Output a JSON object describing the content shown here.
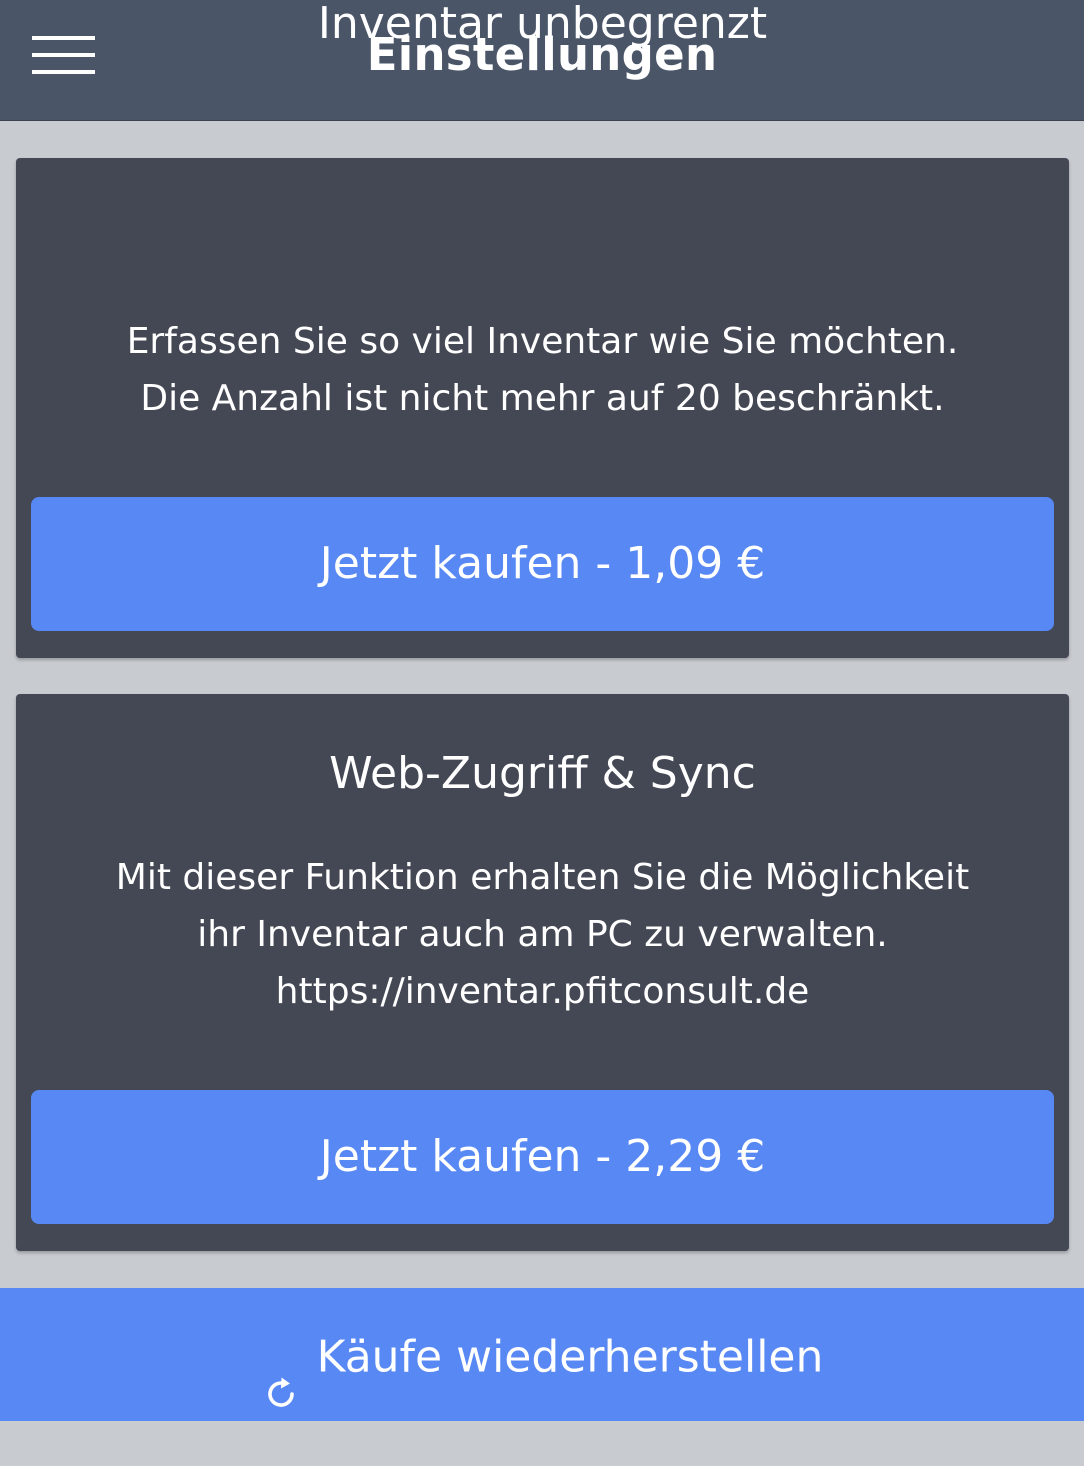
{
  "header": {
    "title": "Einstellungen",
    "menu_icon": "hamburger-menu-icon"
  },
  "products": [
    {
      "title": "Inventar unbegrenzt",
      "description_lines": [
        "Erfassen Sie so viel Inventar wie Sie möchten.",
        "Die Anzahl ist nicht mehr auf 20 beschränkt."
      ],
      "buy_label": "Jetzt kaufen - 1,09 €"
    },
    {
      "title": "Web-Zugriff & Sync",
      "description_lines": [
        "Mit dieser Funktion erhalten Sie die Möglichkeit",
        "ihr Inventar auch am PC zu verwalten.",
        "https://inventar.pfitconsult.de"
      ],
      "buy_label": "Jetzt kaufen - 2,29 €"
    }
  ],
  "restore": {
    "label": "Käufe wiederherstellen",
    "icon": "refresh-icon"
  },
  "colors": {
    "header_bg": "#4a5568",
    "page_bg": "#c8cbd0",
    "card_bg": "#444854",
    "accent": "#5888f4",
    "text": "#ffffff"
  }
}
